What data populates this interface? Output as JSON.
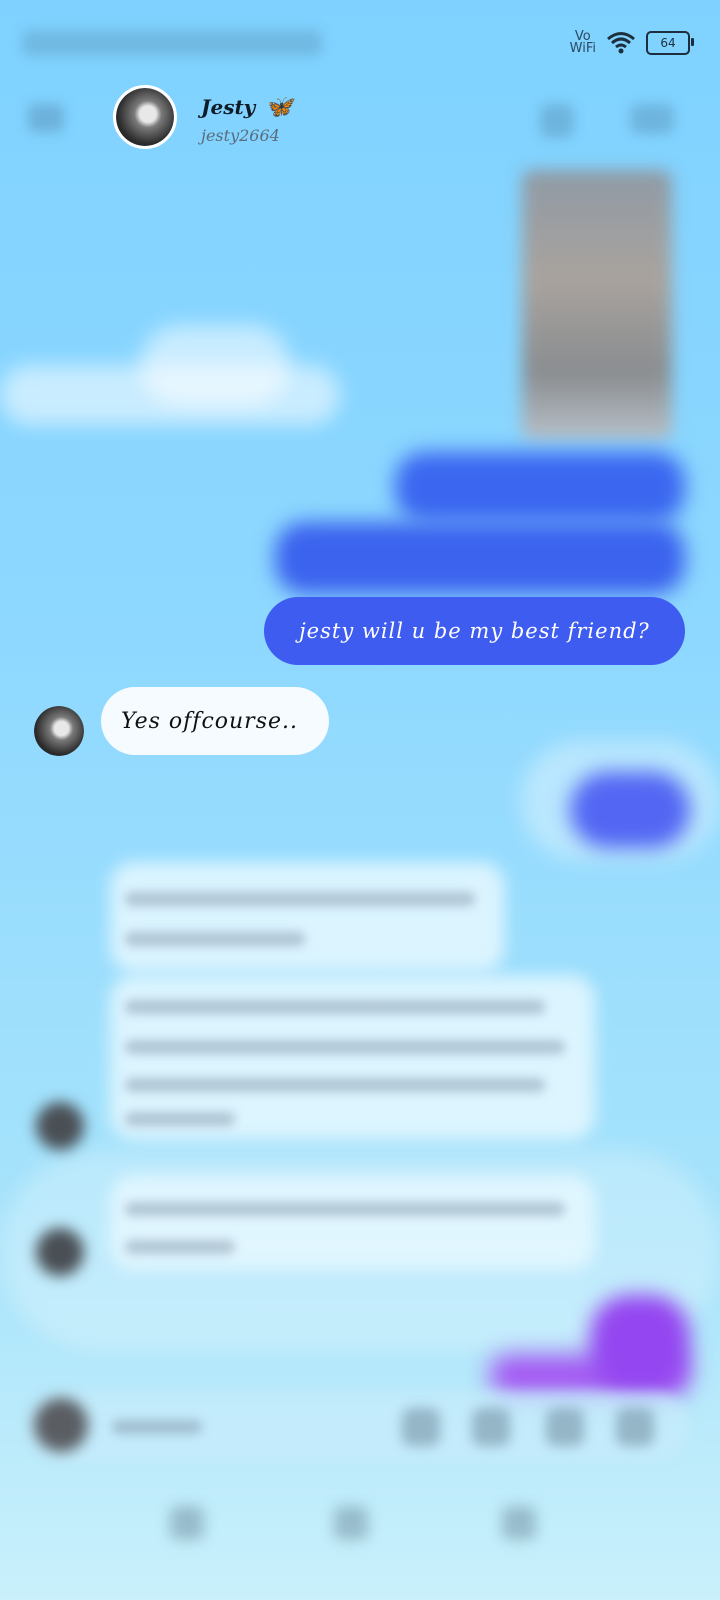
{
  "status_bar": {
    "network_label": "Vo\nWiFi",
    "battery_level": "64"
  },
  "header": {
    "contact_name": "Jesty",
    "contact_handle": "jesty2664",
    "name_icon": "butterfly-icon"
  },
  "messages": {
    "outgoing_question": "jesty will u be my best friend?",
    "incoming_reply": "Yes offcourse.."
  },
  "colors": {
    "outgoing_bubble": "#3f5cf1",
    "incoming_bubble": "#f5fbff",
    "background_top": "#7fd2ff",
    "background_bottom": "#c9f0fb"
  }
}
